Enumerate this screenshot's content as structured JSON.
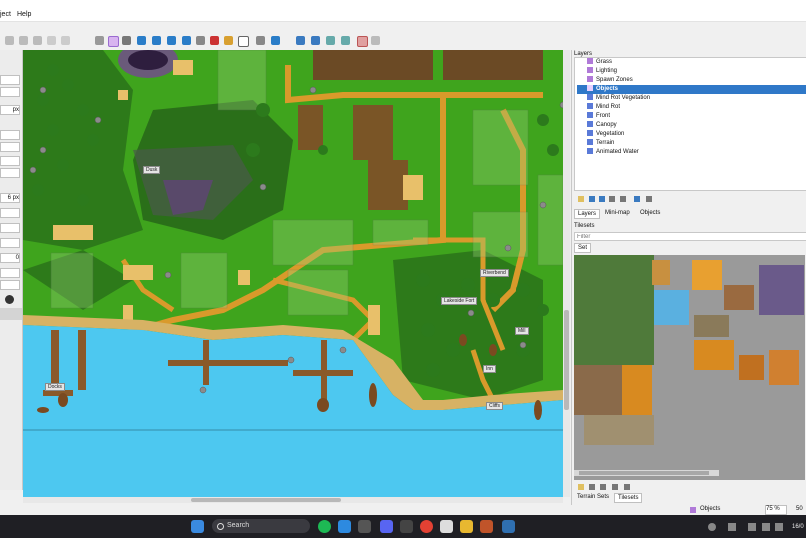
{
  "menubar": {
    "items": [
      "ject",
      "Help"
    ]
  },
  "left_panel": {
    "values": [
      "px",
      "0",
      "6 px"
    ]
  },
  "layers": {
    "header": "Layers",
    "items": [
      {
        "label": "Grass",
        "kind": "object"
      },
      {
        "label": "Lighting",
        "kind": "object"
      },
      {
        "label": "Spawn Zones",
        "kind": "object"
      },
      {
        "label": "Objects",
        "kind": "object",
        "selected": true
      },
      {
        "label": "Mind Rot Vegetation",
        "kind": "tile"
      },
      {
        "label": "Mind Rot",
        "kind": "tile"
      },
      {
        "label": "Front",
        "kind": "tile"
      },
      {
        "label": "Canopy",
        "kind": "tile"
      },
      {
        "label": "Vegetation",
        "kind": "tile"
      },
      {
        "label": "Terrain",
        "kind": "tile"
      },
      {
        "label": "Animated Water",
        "kind": "tile"
      }
    ],
    "tabs": [
      "Layers",
      "Mini-map",
      "Objects"
    ]
  },
  "tilesets": {
    "header": "Tilesets",
    "filter_placeholder": "Filter",
    "set_tab": "Set",
    "bottom_tabs": [
      "Terrain Sets",
      "Tilesets"
    ]
  },
  "status": {
    "layer_select": "Objects",
    "zoom": "75 %",
    "value": "50"
  },
  "taskbar": {
    "search_placeholder": "Search",
    "clock": "16/0"
  },
  "map_labels": [
    "Dusk",
    "Riverbend",
    "Lakeside Fort",
    "Mill",
    "Docks",
    "Cliffs",
    "Inn"
  ],
  "colors": {
    "grass": "#3fa41d",
    "water": "#4dc8f0",
    "selected": "#2f78c8",
    "taskbar": "#1f1f24"
  }
}
